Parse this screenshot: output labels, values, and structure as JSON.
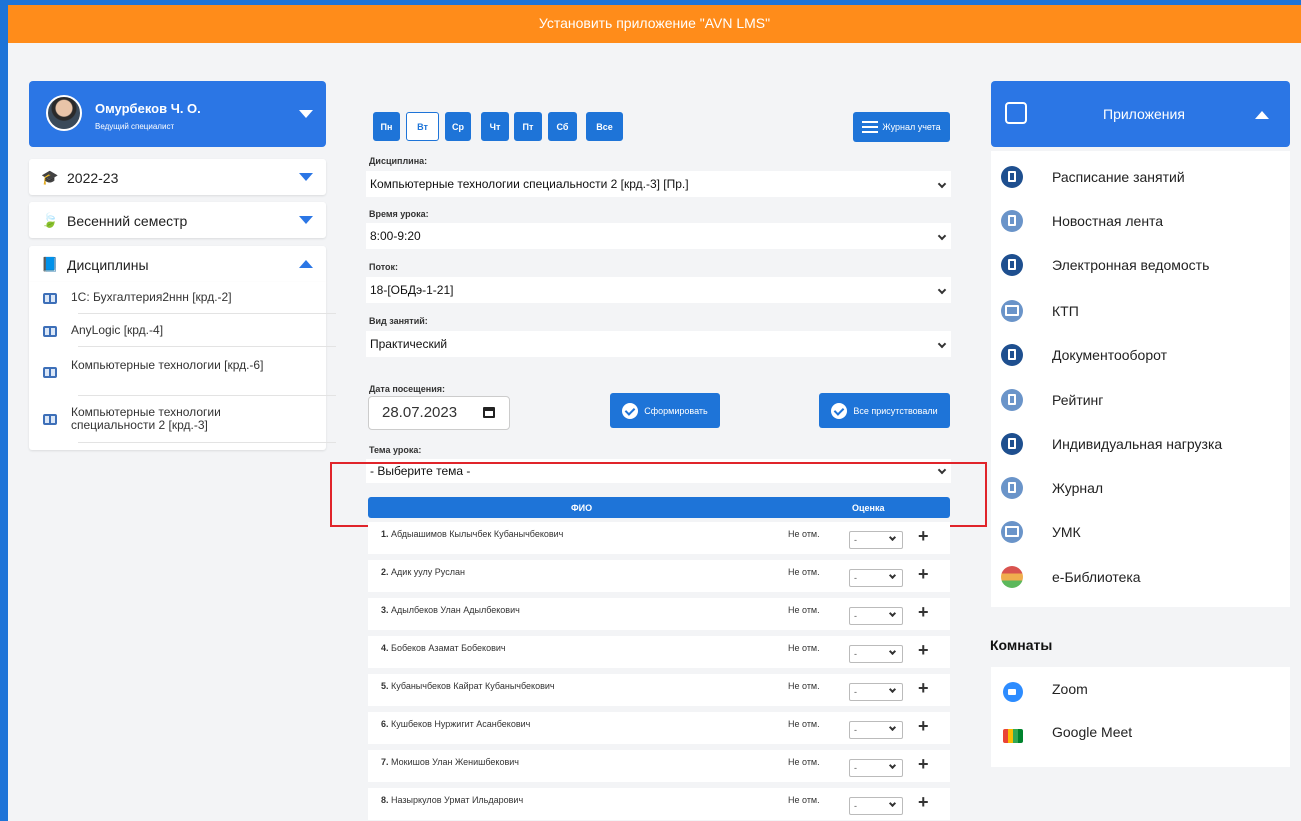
{
  "banner": {
    "text": "Установить приложение \"AVN LMS\""
  },
  "profile": {
    "name": "Омурбеков Ч. О.",
    "role": "Ведущий специалист"
  },
  "year": {
    "label": "2022-23"
  },
  "semester": {
    "label": "Весенний семестр"
  },
  "disciplines": {
    "label": "Дисциплины",
    "items": [
      {
        "label": "1C: Бухгалтерия2ннн [крд.-2]"
      },
      {
        "label": "AnyLogic [крд.-4]"
      },
      {
        "label": "Компьютерные технологии [крд.-6]"
      },
      {
        "label": "Компьютерные технологии специальности 2 [крд.-3]"
      }
    ]
  },
  "days": [
    "Пн",
    "Вт",
    "Ср",
    "Чт",
    "Пт",
    "Сб",
    "Все"
  ],
  "active_day": "Вт",
  "journal_button": "Журнал учета",
  "form": {
    "discipline": {
      "label": "Дисциплина:",
      "value": "Компьютерные технологии специальности 2 [крд.-3] [Пр.]"
    },
    "time": {
      "label": "Время урока:",
      "value": "8:00-9:20"
    },
    "stream": {
      "label": "Поток:",
      "value": "18-[ОБДэ-1-21]"
    },
    "lesson_type": {
      "label": "Вид занятий:",
      "value": "Практический"
    },
    "date": {
      "label": "Дата посещения:",
      "value": "28.07.2023"
    },
    "topic": {
      "label": "Тема урока:",
      "value": "- Выберите тема -"
    }
  },
  "buttons": {
    "generate": "Сформировать",
    "all_present": "Все присутствовали"
  },
  "table": {
    "headers": {
      "fio": "ФИО",
      "grade": "Оценка"
    },
    "rows": [
      {
        "num": "1.",
        "name": "Абдыашимов Кылычбек Кубанычбекович",
        "status": "Не отм.",
        "grade": "-"
      },
      {
        "num": "2.",
        "name": "Адик уулу Руслан",
        "status": "Не отм.",
        "grade": "-"
      },
      {
        "num": "3.",
        "name": "Адылбеков Улан Адылбекович",
        "status": "Не отм.",
        "grade": "-"
      },
      {
        "num": "4.",
        "name": "Бобеков Азамат Бобекович",
        "status": "Не отм.",
        "grade": "-"
      },
      {
        "num": "5.",
        "name": "Кубанычбеков Кайрат Кубанычбекович",
        "status": "Не отм.",
        "grade": "-"
      },
      {
        "num": "6.",
        "name": "Кушбеков Нуржигит Асанбекович",
        "status": "Не отм.",
        "grade": "-"
      },
      {
        "num": "7.",
        "name": "Мокишов Улан Женишбекович",
        "status": "Не отм.",
        "grade": "-"
      },
      {
        "num": "8.",
        "name": "Назыркулов Урмат Ильдарович",
        "status": "Не отм.",
        "grade": "-"
      }
    ]
  },
  "apps": {
    "title": "Приложения",
    "items": [
      {
        "label": "Расписание занятий",
        "icon": "calendar-icon"
      },
      {
        "label": "Новостная лента",
        "icon": "news-icon"
      },
      {
        "label": "Электронная ведомость",
        "icon": "document-icon"
      },
      {
        "label": "КТП",
        "icon": "book-icon"
      },
      {
        "label": "Документооборот",
        "icon": "document-icon"
      },
      {
        "label": "Рейтинг",
        "icon": "rating-icon"
      },
      {
        "label": "Индивидуальная нагрузка",
        "icon": "workload-icon"
      },
      {
        "label": "Журнал",
        "icon": "journal-icon"
      },
      {
        "label": "УМК",
        "icon": "book-icon"
      },
      {
        "label": "e-Библиотека",
        "icon": "library-icon"
      }
    ]
  },
  "rooms": {
    "title": "Комнаты",
    "items": [
      {
        "label": "Zoom"
      },
      {
        "label": "Google Meet"
      }
    ]
  }
}
